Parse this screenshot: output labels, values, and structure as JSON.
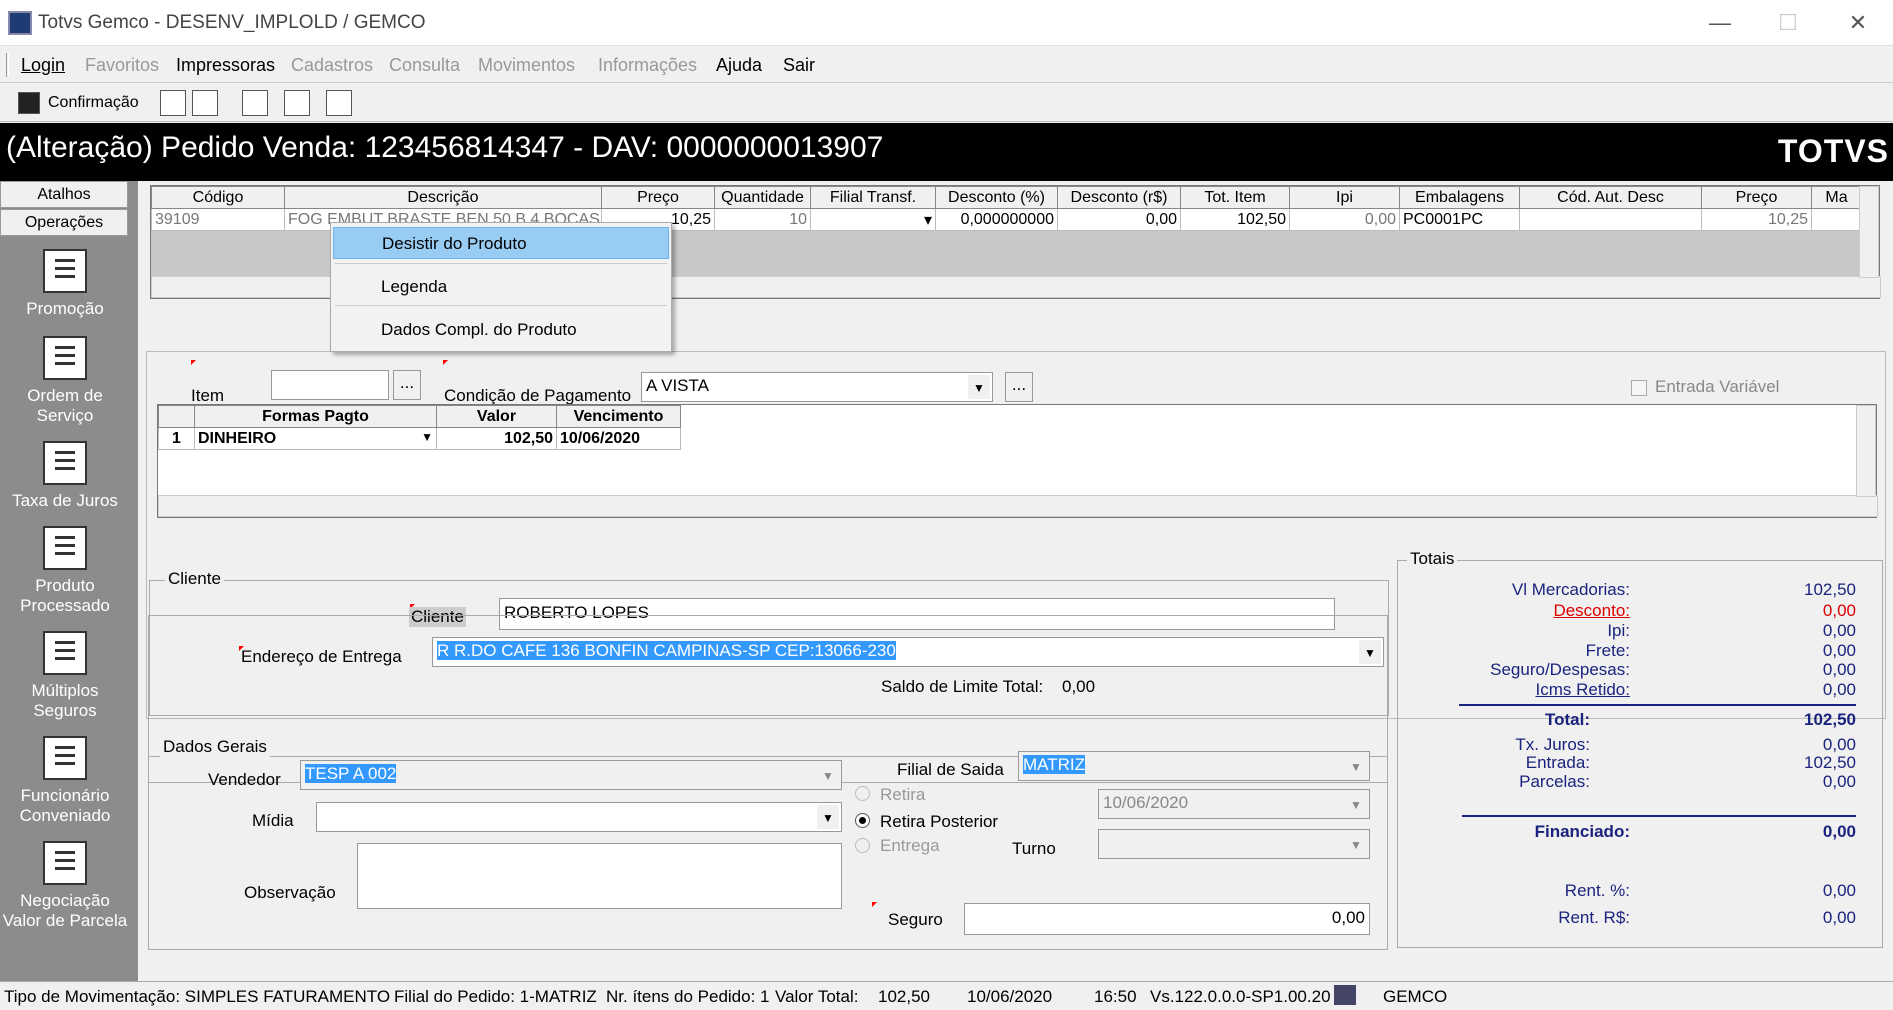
{
  "window": {
    "title": "Totvs Gemco - DESENV_IMPLOLD / GEMCO"
  },
  "menu": {
    "login": "Login",
    "favoritos": "Favoritos",
    "impressoras": "Impressoras",
    "cadastros": "Cadastros",
    "consulta": "Consulta",
    "movimentos": "Movimentos",
    "informacoes": "Informações",
    "ajuda": "Ajuda",
    "sair": "Sair"
  },
  "toolbar": {
    "confirmacao": "Confirmação"
  },
  "header": {
    "title": "(Alteração) Pedido Venda: 123456814347 - DAV: 0000000013907",
    "logo": "TOTVS"
  },
  "sidebar": {
    "atalhos": "Atalhos",
    "operacoes": "Operações",
    "items": [
      "Promoção",
      "Ordem de Serviço",
      "Taxa de Juros",
      "Produto Processado",
      "Múltiplos Seguros",
      "Funcionário Conveniado",
      "Negociação Valor de Parcela"
    ]
  },
  "products": {
    "columns": [
      "Código",
      "Descrição",
      "Preço",
      "Quantidade",
      "Filial Transf.",
      "Desconto (%)",
      "Desconto (r$)",
      "Tot. Item",
      "Ipi",
      "Embalagens",
      "Cód. Aut. Desc",
      "Preço",
      "Ma"
    ],
    "row": {
      "codigo": "39109",
      "descricao": "FOG EMBUT BRASTE BEN 50 B 4 BOCAS",
      "preco": "10,25",
      "quantidade": "10",
      "filial": "",
      "desc_pct": "0,000000000",
      "desc_rs": "0,00",
      "tot_item": "102,50",
      "ipi": "0,00",
      "embalagem": "PC0001PC",
      "cod_aut": "",
      "preco2": "10,25"
    }
  },
  "context_menu": {
    "items": [
      "Desistir do Produto",
      "Legenda",
      "Dados Compl. do Produto"
    ]
  },
  "payment": {
    "item_label": "Item",
    "condicao_label": "Condição de Pagamento",
    "condicao_value": "A VISTA",
    "entrada_variavel": "Entrada Variável",
    "columns": [
      "Formas Pagto",
      "Valor",
      "Vencimento"
    ],
    "rows": [
      {
        "n": "1",
        "forma": "DINHEIRO",
        "valor": "102,50",
        "venc": "10/06/2020"
      }
    ]
  },
  "cliente": {
    "group": "Cliente",
    "cliente_label": "Cliente",
    "cliente_value": "ROBERTO LOPES",
    "endereco_label": "Endereço de Entrega",
    "endereco_value": "R  R.DO CAFE 136 BONFIN CAMPINAS-SP CEP:13066-230",
    "saldo_label": "Saldo de Limite Total:",
    "saldo_value": "0,00"
  },
  "dados": {
    "group": "Dados Gerais",
    "vendedor_label": "Vendedor",
    "vendedor_value": "TESP A 002",
    "midia_label": "Mídia",
    "obs_label": "Observação",
    "filial_label": "Filial de Saida",
    "filial_value": "MATRIZ",
    "retira": "Retira",
    "retira_posterior": "Retira Posterior",
    "entrega": "Entrega",
    "data": "10/06/2020",
    "turno_label": "Turno",
    "seguro_label": "Seguro",
    "seguro_value": "0,00"
  },
  "totais": {
    "group": "Totais",
    "vl_merc_label": "Vl Mercadorias:",
    "vl_merc": "102,50",
    "desconto_label": "Desconto:",
    "desconto": "0,00",
    "ipi_label": "Ipi:",
    "ipi": "0,00",
    "frete_label": "Frete:",
    "frete": "0,00",
    "seguro_label": "Seguro/Despesas:",
    "seguro": "0,00",
    "icms_label": "Icms Retido:",
    "icms": "0,00",
    "total_label": "Total:",
    "total": "102,50",
    "juros_label": "Tx. Juros:",
    "juros": "0,00",
    "entrada_label": "Entrada:",
    "entrada": "102,50",
    "parcelas_label": "Parcelas:",
    "parcelas": "0,00",
    "financiado_label": "Financiado:",
    "financiado": "0,00",
    "rent_pct_label": "Rent. %:",
    "rent_pct": "0,00",
    "rent_rs_label": "Rent. R$:",
    "rent_rs": "0,00"
  },
  "status": {
    "tipo": "Tipo de Movimentação: SIMPLES FATURAMENTO",
    "filial": "Filial do Pedido: 1-MATRIZ",
    "itens": "Nr. ítens do Pedido: 1",
    "valor_label": "Valor Total:",
    "valor": "102,50",
    "data": "10/06/2020",
    "hora": "16:50",
    "versao": "Vs.122.0.0.0-SP1.00.20",
    "user": "GEMCO"
  }
}
